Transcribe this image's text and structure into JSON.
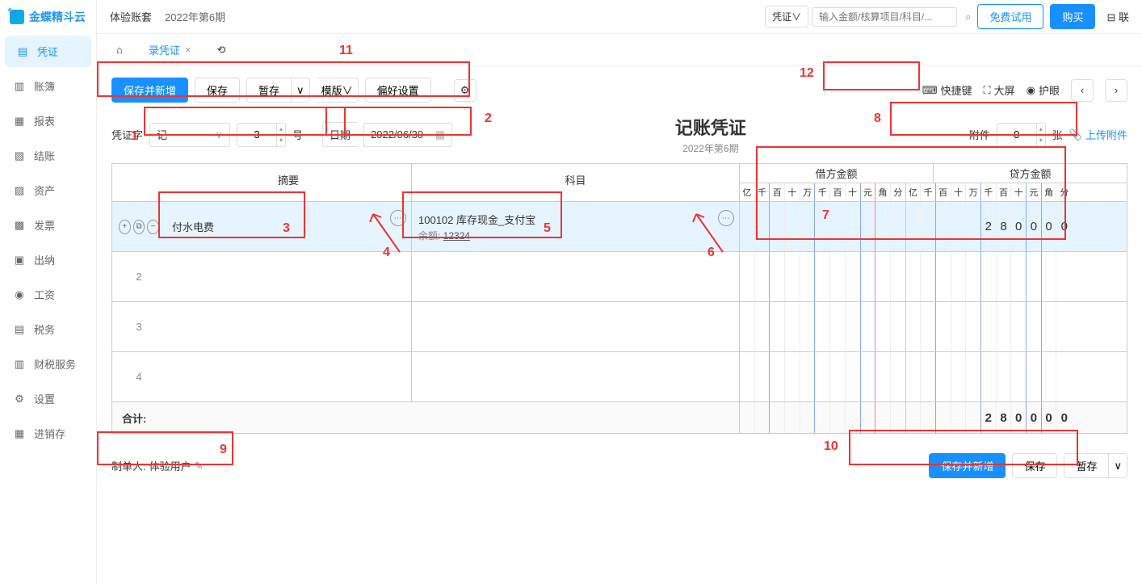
{
  "logo": {
    "text": "金蝶精斗云"
  },
  "top": {
    "account": "体验账套",
    "period": "2022年第6期",
    "searchType": "凭证",
    "searchPlaceholder": "输入金额/核算项目/科目/...",
    "trial": "免费试用",
    "buy": "购买",
    "contact": "联"
  },
  "nav": [
    "凭证",
    "账簿",
    "报表",
    "结账",
    "资产",
    "发票",
    "出纳",
    "工资",
    "税务",
    "财税服务",
    "设置",
    "进销存"
  ],
  "tabs": {
    "main": "录凭证"
  },
  "toolbar": {
    "saveNew": "保存并新增",
    "save": "保存",
    "draft": "暂存",
    "template": "模版",
    "preference": "偏好设置",
    "shortcut": "快捷键",
    "fullscreen": "大屏",
    "eyecare": "护眼"
  },
  "voucher": {
    "title": "记账凭证",
    "period": "2022年第6期",
    "wordLabel": "凭证字",
    "word": "记",
    "number": "3",
    "numberSuffix": "号",
    "dateLabel": "日期",
    "date": "2022/06/30",
    "attachLabel": "附件",
    "attachCount": "0",
    "attachSuffix": "张",
    "upload": "上传附件"
  },
  "table": {
    "summaryHeader": "摘要",
    "subjectHeader": "科目",
    "debitHeader": "借方金额",
    "creditHeader": "贷方金额",
    "digits": [
      "亿",
      "千",
      "百",
      "十",
      "万",
      "千",
      "百",
      "十",
      "元",
      "角",
      "分"
    ],
    "rows": [
      {
        "summary": "付水电费",
        "subject": "100102 库存现金_支付宝",
        "balanceLabel": "余额:",
        "balance": "12324",
        "credit": [
          "",
          "",
          "",
          "",
          "",
          "2",
          "8",
          "0",
          "0",
          "0",
          "0"
        ]
      },
      {},
      {},
      {}
    ],
    "rowNums": [
      "",
      "2",
      "3",
      "4"
    ],
    "totalLabel": "合计:",
    "totalCredit": [
      "",
      "",
      "",
      "",
      "",
      "2",
      "8",
      "0",
      "0",
      "0",
      "0"
    ]
  },
  "bottom": {
    "creatorLabel": "制单人:",
    "creator": "体验用户",
    "saveNew": "保存并新增",
    "save": "保存",
    "draft": "暂存"
  },
  "annotations": {
    "nums": [
      "1",
      "2",
      "3",
      "4",
      "5",
      "6",
      "7",
      "8",
      "9",
      "10",
      "11",
      "12"
    ]
  }
}
